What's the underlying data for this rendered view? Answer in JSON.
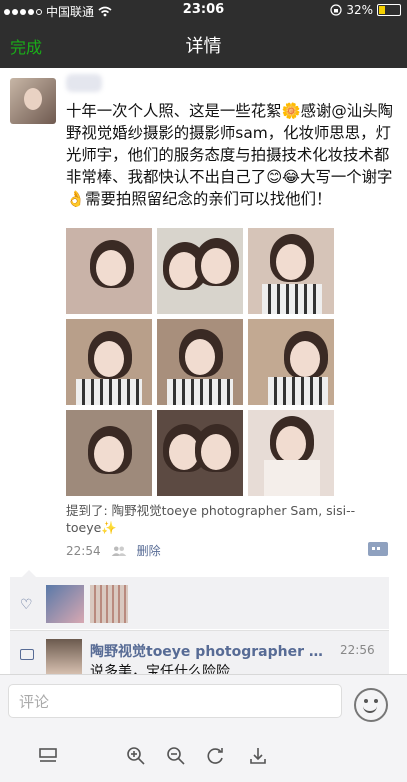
{
  "status_bar": {
    "carrier": "中国联通",
    "time": "23:06",
    "battery": "32%",
    "battery_level": 0.32,
    "battery_color": "#f5d000"
  },
  "nav": {
    "done_label": "完成",
    "title": "详情",
    "done_color": "#1aad19"
  },
  "post": {
    "text": "十年一次个人照、这是一些花絮🌼感谢@汕头陶野视觉婚纱摄影的摄影师sam，化妆师思思，灯光师宇，他们的服务态度与拍摄技术化妆技术都非常棒、我都快认不出自己了😊😂大写一个谢字👌需要拍照留纪念的亲们可以找他们！",
    "mention": "提到了: 陶野视觉toeye photographer Sam, sisi--toeye✨",
    "time": "22:54",
    "delete_label": "删除",
    "link_color": "#576b95"
  },
  "comment": {
    "name": "陶野视觉toeye photographer S...",
    "time": "22:56",
    "text": "说多美，宝任什么险险"
  },
  "input": {
    "placeholder": "评论"
  },
  "icons": [
    "wifi-icon",
    "lock-rotation-icon",
    "battery-icon",
    "friends-icon",
    "comment-menu-icon",
    "heart-icon",
    "comment-bubble-icon",
    "emoji-icon",
    "layout-icon",
    "zoom-in-icon",
    "zoom-out-icon",
    "rotate-icon",
    "download-icon"
  ]
}
